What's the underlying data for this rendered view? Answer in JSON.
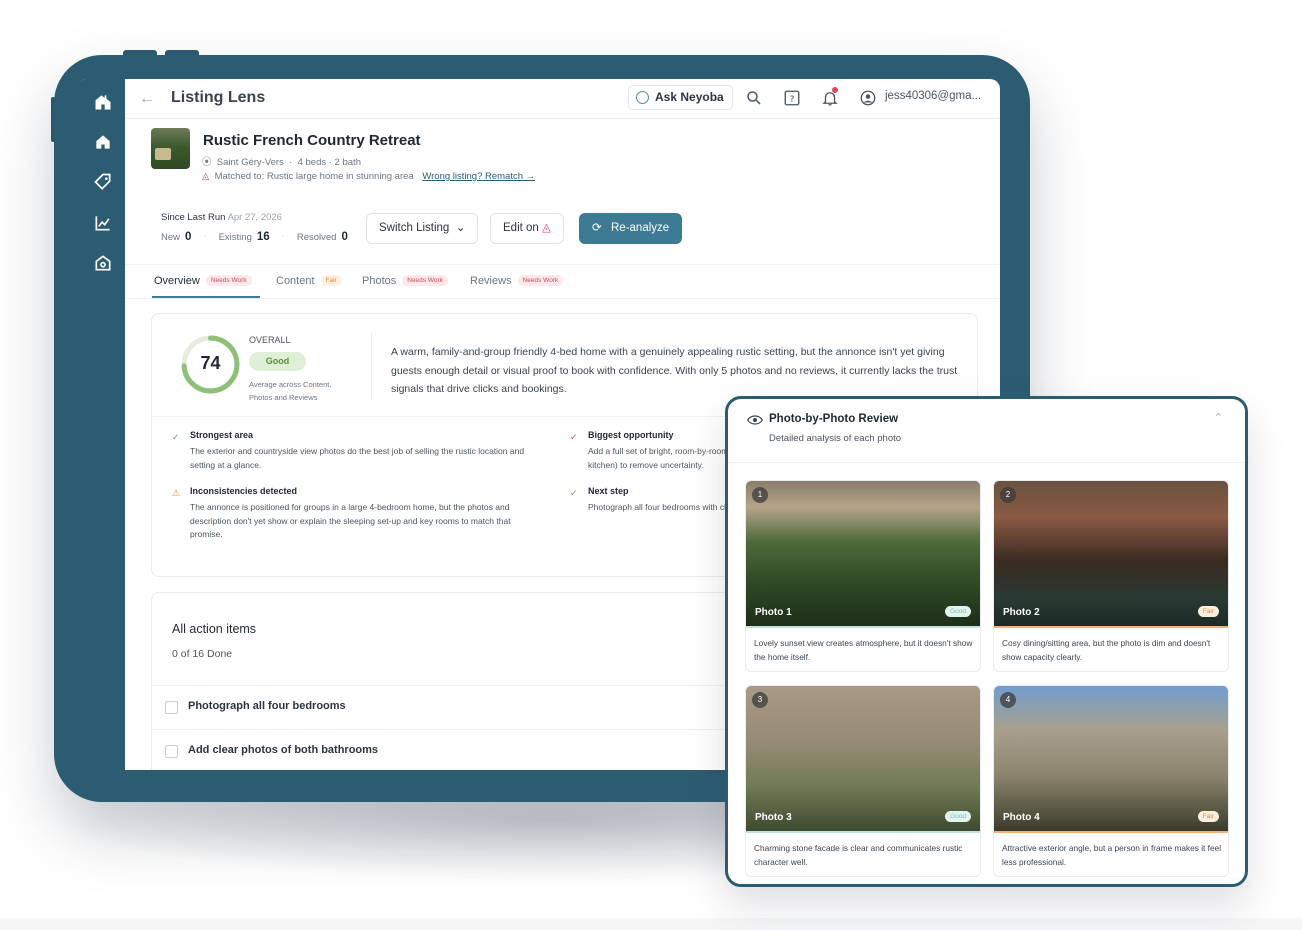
{
  "app": {
    "title": "Listing Lens",
    "ask_label": "Ask Neyoba",
    "user": "jess40306@gma..."
  },
  "listing": {
    "title": "Rustic French Country Retreat",
    "location": "Saint Géry-Vers",
    "beds_bath": "4 beds · 2 bath",
    "matched": "Matched to: Rustic large home in stunning area",
    "rematch": "Wrong listing? Rematch →"
  },
  "run": {
    "since_label": "Since Last Run",
    "since_date": "Apr 27, 2026",
    "new_label": "New",
    "new_count": "0",
    "existing_label": "Existing",
    "existing_count": "16",
    "resolved_label": "Resolved",
    "resolved_count": "0"
  },
  "toolbar": {
    "switch_label": "Switch Listing",
    "edit_label": "Edit on",
    "reanalyze_label": "Re-analyze"
  },
  "tabs": [
    {
      "label": "Overview",
      "badge": "Needs Work"
    },
    {
      "label": "Content",
      "badge": "Fair"
    },
    {
      "label": "Photos",
      "badge": "Needs Work"
    },
    {
      "label": "Reviews",
      "badge": "Needs Work"
    }
  ],
  "overall": {
    "label": "OVERALL",
    "score": "74",
    "score_fraction": 0.74,
    "rating": "Good",
    "note": "Average across Content, Photos and Reviews",
    "summary": "A warm, family-and-group friendly 4-bed home with a genuinely appealing rustic setting, but the annonce isn't yet giving guests enough detail or visual proof to book with confidence. With only 5 photos and no reviews, it currently lacks the trust signals that drive clicks and bookings."
  },
  "insights": [
    {
      "heading": "Strongest area",
      "text": "The exterior and countryside view photos do the best job of selling the rustic location and setting at a glance.",
      "icon": "check-icon"
    },
    {
      "heading": "Biggest opportunity",
      "text": "Add a full set of bright, room-by-room photos, especially the bedrooms, bathrooms and the kitchen) to remove uncertainty.",
      "icon": "check-icon"
    },
    {
      "heading": "Inconsistencies detected",
      "text": "The annonce is positioned for groups in a large 4-bedroom home, but the photos and description don't yet show or explain the sleeping set-up and key rooms to match that promise.",
      "icon": "warning-icon"
    },
    {
      "heading": "Next step",
      "text": "Photograph all four bedrooms with clear views of beds and layout.",
      "icon": "check-icon"
    }
  ],
  "actions": {
    "title": "All action items",
    "done": "0 of 16 Done",
    "items": [
      "Photograph all four bedrooms",
      "Add clear photos of both bathrooms"
    ]
  },
  "photo_review": {
    "title": "Photo-by-Photo Review",
    "subtitle": "Detailed analysis of each photo",
    "photos": [
      {
        "num": "1",
        "label": "Photo 1",
        "rating": "Good",
        "caption": "Lovely sunset view creates atmosphere, but it doesn't show the home itself."
      },
      {
        "num": "2",
        "label": "Photo 2",
        "rating": "Fair",
        "caption": "Cosy dining/sitting area, but the photo is dim and doesn't show capacity clearly."
      },
      {
        "num": "3",
        "label": "Photo 3",
        "rating": "Good",
        "caption": "Charming stone facade is clear and communicates rustic character well."
      },
      {
        "num": "4",
        "label": "Photo 4",
        "rating": "Fair",
        "caption": "Attractive exterior angle, but a person in frame makes it feel less professional."
      }
    ]
  },
  "colors": {
    "brand": "#2c5c72",
    "accent": "#3d7a93",
    "good": "#5fa85f",
    "fair": "#e08b3c",
    "bad": "#d24a5c"
  }
}
